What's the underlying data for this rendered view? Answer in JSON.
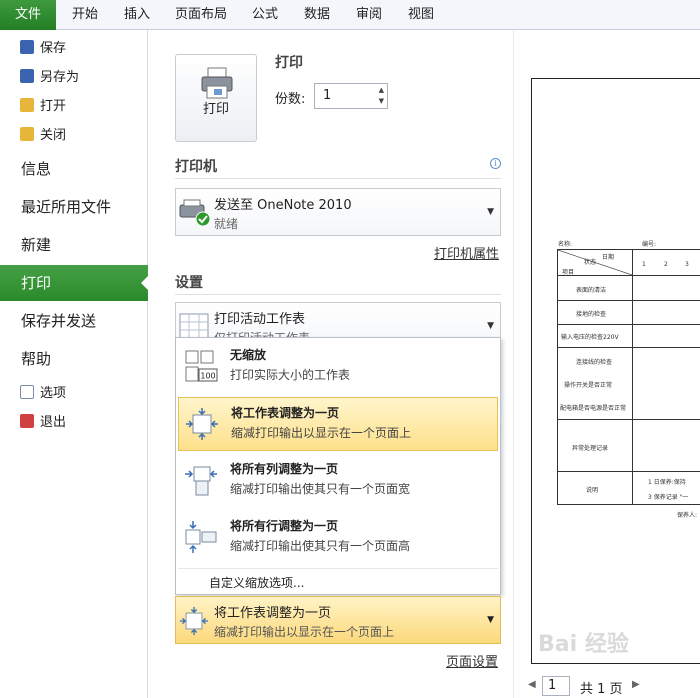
{
  "ribbon": {
    "tabs": [
      "文件",
      "开始",
      "插入",
      "页面布局",
      "公式",
      "数据",
      "审阅",
      "视图"
    ]
  },
  "nav": {
    "small_top": [
      {
        "label": "保存",
        "icon": "save-icon",
        "color": "#3a64b0"
      },
      {
        "label": "另存为",
        "icon": "save-as-icon",
        "color": "#3a64b0"
      },
      {
        "label": "打开",
        "icon": "folder-open-icon",
        "color": "#e8b53b"
      },
      {
        "label": "关闭",
        "icon": "folder-close-icon",
        "color": "#e8b53b"
      }
    ],
    "large": [
      "信息",
      "最近所用文件",
      "新建",
      "打印",
      "保存并发送",
      "帮助"
    ],
    "active": "打印",
    "small_bottom": [
      {
        "label": "选项",
        "icon": "options-icon",
        "color": "#7d8fa8"
      },
      {
        "label": "退出",
        "icon": "exit-icon",
        "color": "#d04040"
      }
    ]
  },
  "print": {
    "section_title": "打印",
    "button_label": "打印",
    "copies_label": "份数:",
    "copies_value": "1"
  },
  "printer": {
    "section_title": "打印机",
    "name": "发送至 OneNote 2010",
    "status": "就绪",
    "properties_link": "打印机属性"
  },
  "settings": {
    "section_title": "设置",
    "print_what_title": "打印活动工作表",
    "print_what_desc": "仅打印活动工作表",
    "scaling_options": [
      {
        "title": "无缩放",
        "desc": "打印实际大小的工作表",
        "icon": "no-scaling-icon",
        "badge": "100"
      },
      {
        "title": "将工作表调整为一页",
        "desc": "缩减打印输出以显示在一个页面上",
        "icon": "fit-sheet-icon"
      },
      {
        "title": "将所有列调整为一页",
        "desc": "缩减打印输出使其只有一个页面宽",
        "icon": "fit-columns-icon"
      },
      {
        "title": "将所有行调整为一页",
        "desc": "缩减打印输出使其只有一个页面高",
        "icon": "fit-rows-icon"
      }
    ],
    "selected_index": 1,
    "custom_scaling": "自定义缩放选项...",
    "current_scaling_title": "将工作表调整为一页",
    "current_scaling_desc": "缩减打印输出以显示在一个页面上",
    "page_setup_link": "页面设置"
  },
  "preview": {
    "header_name": "名称:",
    "header_no": "编号:",
    "corner_top": "日期",
    "corner_mid": "状态",
    "corner_bottom": "项目",
    "columns": [
      "1",
      "2",
      "3"
    ],
    "rows": [
      "表面的清洁",
      "接地的检查",
      "输入电压的检查220V",
      "连接线的检查",
      "操作开关是否正常",
      "配电箱是否电源是否正常",
      "异常处理记录",
      "说明"
    ],
    "notes": [
      "1 日保养:保持",
      "3 保养记录 \"一"
    ],
    "footer": "保养人:",
    "page_current": "1",
    "page_total": "共 1 页"
  },
  "watermark": "Bai 经验"
}
